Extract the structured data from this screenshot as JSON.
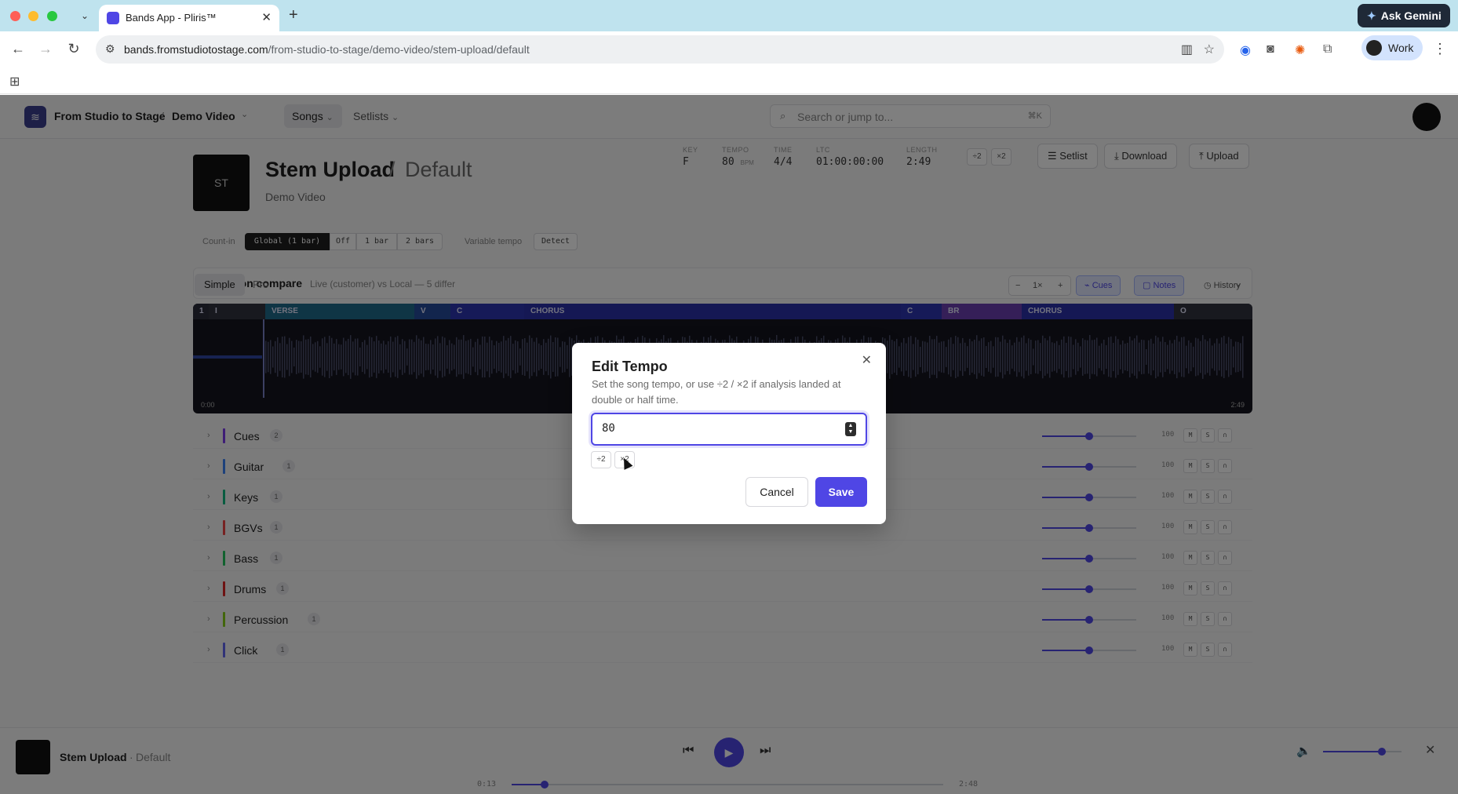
{
  "browser": {
    "tab_title": "Bands App - Pliris™",
    "new_tab": "+",
    "tab_close": "✕",
    "gemini_label": "Ask Gemini",
    "url_domain": "bands.fromstudiotostage.com",
    "url_path": "/from-studio-to-stage/demo-video/stem-upload/default",
    "profile_label": "Work"
  },
  "app": {
    "org": "From Studio to Stage",
    "crumb_sep": "/",
    "project": "Demo Video",
    "nav_songs": "Songs",
    "nav_setlists": "Setlists",
    "search_placeholder": "Search or jump to...",
    "search_shortcut": "⌘K"
  },
  "song": {
    "art_initials": "ST",
    "title": "Stem Upload",
    "slash": "/",
    "version": "Default",
    "subtitle": "Demo Video",
    "meta": [
      {
        "label": "KEY",
        "value": "F",
        "unit": ""
      },
      {
        "label": "TEMPO",
        "value": "80",
        "unit": "BPM"
      },
      {
        "label": "TIME",
        "value": "4/4",
        "unit": ""
      },
      {
        "label": "LTC",
        "value": "01:00:00:00",
        "unit": ""
      },
      {
        "label": "LENGTH",
        "value": "2:49",
        "unit": ""
      }
    ],
    "half_label": "÷2",
    "double_label": "×2",
    "setlist_btn": "Setlist",
    "download_btn": "Download",
    "upload_btn": "Upload"
  },
  "countin": {
    "label": "Count-in",
    "options": [
      "Global (1 bar)",
      "Off",
      "1 bar",
      "2 bars"
    ],
    "selected": "Global (1 bar)",
    "variable_tempo_label": "Variable tempo",
    "detect_label": "Detect"
  },
  "detection": {
    "title": "Detection compare",
    "subtitle": "Live (customer) vs Local — 5 differ"
  },
  "modes": {
    "simple": "Simple",
    "pro": "Pro"
  },
  "view": {
    "zoom_minus": "−",
    "zoom_value": "1×",
    "zoom_plus": "+",
    "cues": "Cues",
    "notes": "Notes",
    "history": "History"
  },
  "waveform": {
    "sections": [
      "1",
      "I",
      "VERSE",
      "V",
      "C",
      "CHORUS",
      "C",
      "BR",
      "CHORUS",
      "O"
    ],
    "start_time": "0:00",
    "end_time": "2:49"
  },
  "tracks": [
    {
      "name": "Cues",
      "count": "2",
      "volume": "100",
      "level": 0.5,
      "color": "#7c3aed"
    },
    {
      "name": "Guitar",
      "count": "1",
      "volume": "100",
      "level": 0.5,
      "color": "#3b82f6"
    },
    {
      "name": "Keys",
      "count": "1",
      "volume": "100",
      "level": 0.5,
      "color": "#10b981"
    },
    {
      "name": "BGVs",
      "count": "1",
      "volume": "100",
      "level": 0.5,
      "color": "#ef4444"
    },
    {
      "name": "Bass",
      "count": "1",
      "volume": "100",
      "level": 0.5,
      "color": "#22c55e"
    },
    {
      "name": "Drums",
      "count": "1",
      "volume": "100",
      "level": 0.5,
      "color": "#dc2626"
    },
    {
      "name": "Percussion",
      "count": "1",
      "volume": "100",
      "level": 0.5,
      "color": "#84cc16"
    },
    {
      "name": "Click",
      "count": "1",
      "volume": "100",
      "level": 0.5,
      "color": "#6366f1"
    }
  ],
  "track_buttons": {
    "mute": "M",
    "solo": "S"
  },
  "player": {
    "title": "Stem Upload",
    "dot": "·",
    "version": "Default",
    "current_time": "0:13",
    "end_time": "2:48",
    "progress": 0.077,
    "volume": 0.75
  },
  "modal": {
    "title": "Edit Tempo",
    "description": "Set the song tempo, or use ÷2 / ×2 if analysis landed at double or half time.",
    "value": "80",
    "half_label": "÷2",
    "double_label": "×2",
    "cancel": "Cancel",
    "save": "Save"
  },
  "colors": {
    "accent": "#4f46e5",
    "waveform_bg": "#14151f"
  }
}
